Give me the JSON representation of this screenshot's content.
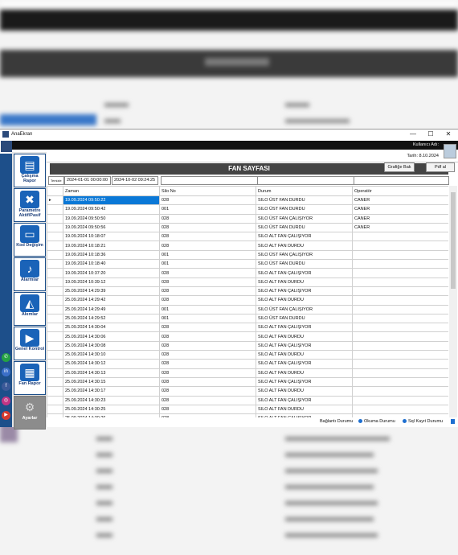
{
  "window": {
    "title": "AnaEkran",
    "minimize": "—",
    "maximize": "☐",
    "close": "✕"
  },
  "header": {
    "user": "Kullanıcı Adı:",
    "date": "Tarih: 8.10.2024"
  },
  "nav": [
    {
      "label": "Çalışma Rapor",
      "icon": "report-icon",
      "glyph": "▤"
    },
    {
      "label": "Parametre Aktif/Pasif",
      "icon": "tools-icon",
      "glyph": "✖"
    },
    {
      "label": "Kod Değişim",
      "icon": "card-icon",
      "glyph": "▭"
    },
    {
      "label": "Alarmlar",
      "icon": "bell-icon",
      "glyph": "♪"
    },
    {
      "label": "Akımlar",
      "icon": "chart-icon",
      "glyph": "◭"
    },
    {
      "label": "Genel Kontrol",
      "icon": "play-icon",
      "glyph": "▶"
    },
    {
      "label": "Fan Rapor",
      "icon": "gift-icon",
      "glyph": "▦"
    },
    {
      "label": "Ayarlar",
      "icon": "gear-icon",
      "glyph": "⚙"
    }
  ],
  "page": {
    "title": "FAN SAYFASI",
    "grafige_bak": "Grafiğe Bak",
    "pdf_al": "Pdf al"
  },
  "filter": {
    "label": "Temizle",
    "start": "2024-01-01 00:00:00",
    "end": "2024-10-02 09:24:25"
  },
  "table": {
    "columns": [
      "Zaman",
      "Silo No",
      "Durum",
      "Operatör"
    ],
    "rows": [
      [
        "19.09.2024 09:50:22",
        "028",
        "SILO  ÜST FAN DURDU",
        "CANER"
      ],
      [
        "19.09.2024 09:50:42",
        "001",
        "SILO  ÜST FAN DURDU",
        "CANER"
      ],
      [
        "19.09.2024 09:50:50",
        "028",
        "SILO  ÜST FAN ÇALIŞIYOR",
        "CANER"
      ],
      [
        "19.09.2024 09:50:56",
        "028",
        "SILO  ÜST FAN DURDU",
        "CANER"
      ],
      [
        "19.09.2024 10:18:07",
        "028",
        "SILO  ALT FAN ÇALIŞIYOR",
        ""
      ],
      [
        "19.09.2024 10:18:21",
        "028",
        "SILO  ALT FAN DURDU",
        ""
      ],
      [
        "19.09.2024 10:18:36",
        "001",
        "SILO  ÜST FAN ÇALIŞIYOR",
        ""
      ],
      [
        "19.09.2024 10:18:40",
        "001",
        "SILO  ÜST FAN DURDU",
        ""
      ],
      [
        "19.09.2024 10:37:20",
        "028",
        "SILO  ALT FAN ÇALIŞIYOR",
        ""
      ],
      [
        "19.09.2024 10:39:12",
        "028",
        "SILO  ALT FAN DURDU",
        ""
      ],
      [
        "25.09.2024 14:29:39",
        "028",
        "SILO  ALT FAN ÇALIŞIYOR",
        ""
      ],
      [
        "25.09.2024 14:29:42",
        "028",
        "SILO  ALT FAN DURDU",
        ""
      ],
      [
        "25.09.2024 14:29:49",
        "001",
        "SILO  ÜST FAN ÇALIŞIYOR",
        ""
      ],
      [
        "25.09.2024 14:29:52",
        "001",
        "SILO  ÜST FAN DURDU",
        ""
      ],
      [
        "25.09.2024 14:30:04",
        "028",
        "SILO  ALT FAN ÇALIŞIYOR",
        ""
      ],
      [
        "25.09.2024 14:30:06",
        "028",
        "SILO  ALT FAN DURDU",
        ""
      ],
      [
        "25.09.2024 14:30:08",
        "028",
        "SILO  ALT FAN ÇALIŞIYOR",
        ""
      ],
      [
        "25.09.2024 14:30:10",
        "028",
        "SILO  ALT FAN DURDU",
        ""
      ],
      [
        "25.09.2024 14:30:12",
        "028",
        "SILO  ALT FAN ÇALIŞIYOR",
        ""
      ],
      [
        "25.09.2024 14:30:13",
        "028",
        "SILO  ALT FAN DURDU",
        ""
      ],
      [
        "25.09.2024 14:30:15",
        "028",
        "SILO  ALT FAN ÇALIŞIYOR",
        ""
      ],
      [
        "25.09.2024 14:30:17",
        "028",
        "SILO  ALT FAN DURDU",
        ""
      ],
      [
        "25.09.2024 14:30:23",
        "028",
        "SILO  ALT FAN ÇALIŞIYOR",
        ""
      ],
      [
        "25.09.2024 14:30:25",
        "028",
        "SILO  ALT FAN DURDU",
        ""
      ],
      [
        "25.09.2024 14:30:26",
        "028",
        "SILO  ALT FAN ÇALIŞIYOR",
        ""
      ]
    ]
  },
  "status": {
    "baglanti": "Bağlantı Durumu",
    "okuma": "Okuma Durumu",
    "sql": "Sql Kayıt Durumu",
    "colors": {
      "green": "#2ecc40",
      "blue": "#1e6fd0"
    }
  }
}
